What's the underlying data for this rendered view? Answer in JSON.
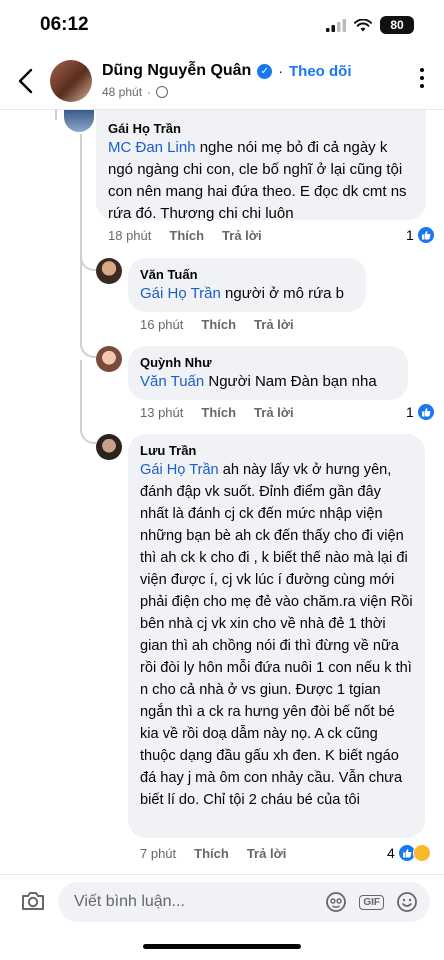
{
  "status": {
    "time": "06:12",
    "battery": "80"
  },
  "header": {
    "name": "Dũng Nguyễn Quân",
    "separator": "·",
    "follow_label": "Theo dõi",
    "time": "48 phút"
  },
  "comments": [
    {
      "author": "Gái Họ Trần",
      "mention": "MC Đan Linh",
      "text": " nghe nói mẹ bỏ đi cả ngày k ngó ngàng chi con, cle bố nghĩ ở lại cũng tội con nên mang hai đứa theo. E đọc dk cmt ns rứa đó. Thương chi chi luôn",
      "time": "18 phút",
      "like": "Thích",
      "reply": "Trả lời",
      "reactions": "1"
    },
    {
      "author": "Văn Tuấn",
      "mention": "Gái Họ Trần",
      "text": " người ở mô rứa b",
      "time": "16 phút",
      "like": "Thích",
      "reply": "Trả lời"
    },
    {
      "author": "Quỳnh Như",
      "mention": "Văn Tuấn",
      "text": " Người Nam Đàn bạn nha",
      "time": "13 phút",
      "like": "Thích",
      "reply": "Trả lời",
      "reactions": "1"
    },
    {
      "author": "Lưu Trần",
      "mention": "Gái Họ Trần",
      "text": " ah này lấy vk ở hưng yên, đánh đập vk suốt. Đỉnh điểm gần đây nhất là đánh cj ck đến mức nhập viện những bạn bè ah ck đến thấy cho đi viện thì ah ck k cho đi , k biết thế nào mà lại đi viện được í, cj vk lúc í đường cùng mới phải điện cho mẹ đẻ vào chăm.ra viện  Rồi bên nhà cj vk xin cho về nhà đẻ 1 thời gian thì ah chồng nói đi thì đừng về nữa rồi đòi ly hôn mỗi đứa nuôi 1 con nếu k thì n cho cả nhà ở vs giun. Được 1 tgian ngắn thì a ck ra hưng yên đòi bế nốt bé kia về rồi doạ dẫm này nọ. A ck cũng thuộc dạng đầu gấu xh đen. K biết ngáo đá hay j mà ôm con nhảy cầu. Vẫn chưa biết lí do. Chỉ tội 2 cháu bé của tôi",
      "time": "7 phút",
      "like": "Thích",
      "reply": "Trả lời",
      "reactions": "4"
    }
  ],
  "composer": {
    "placeholder": "Viết bình luận..."
  }
}
